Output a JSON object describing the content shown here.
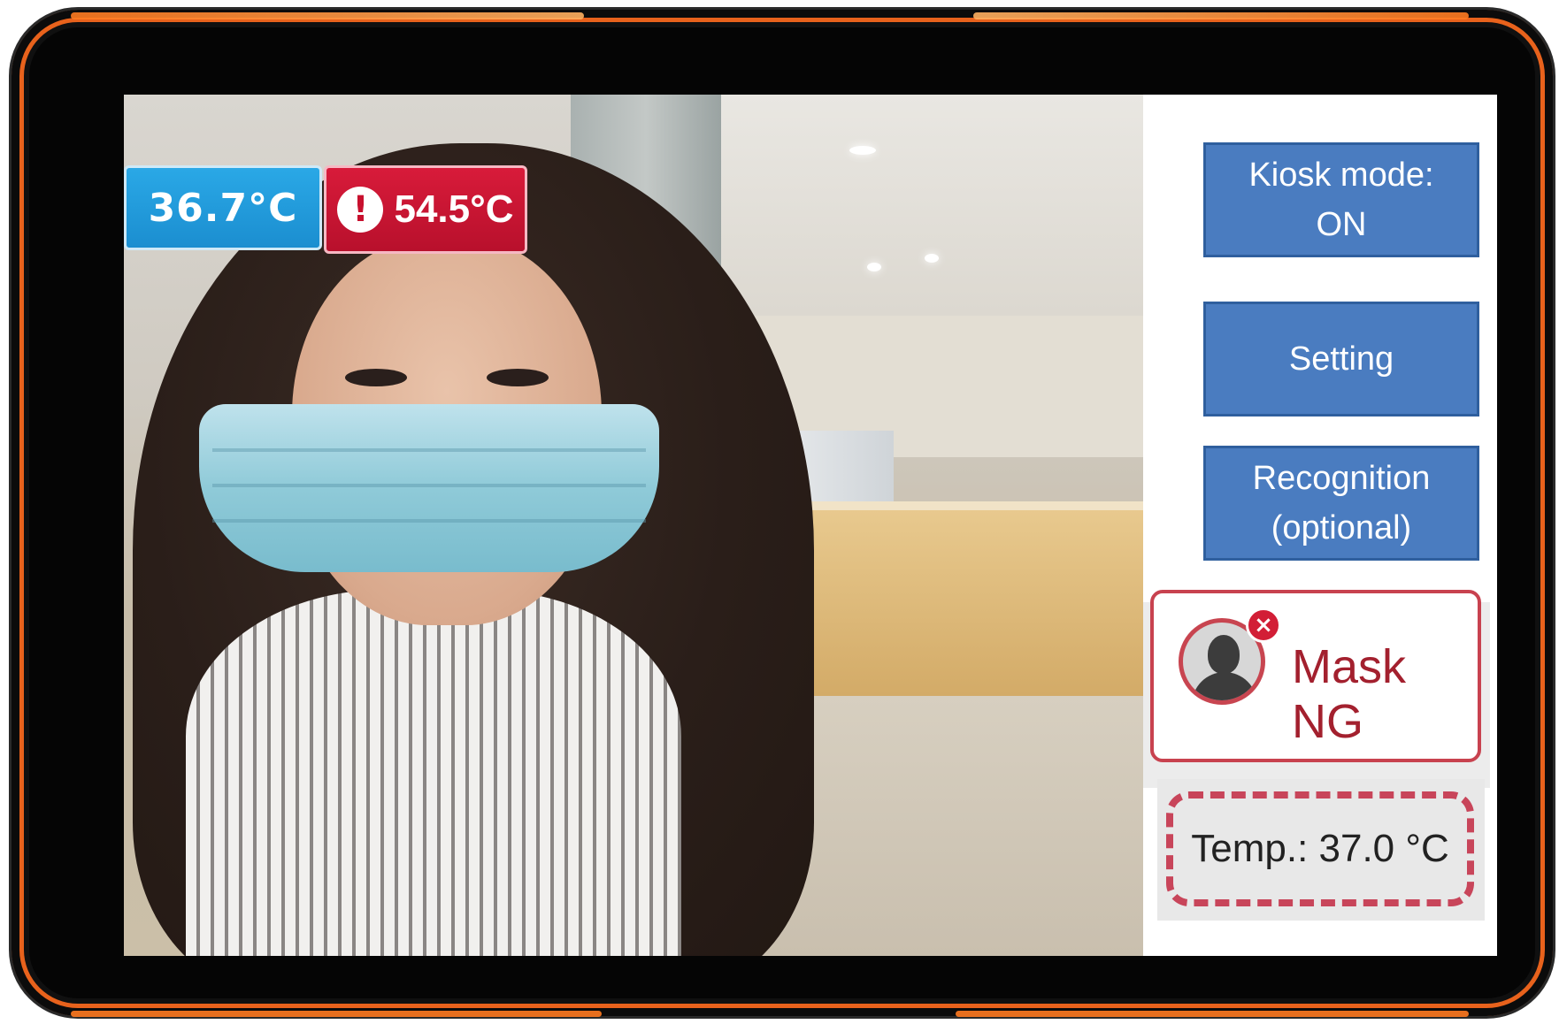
{
  "camera_view": {
    "temp_reading_normal": "36.7°C",
    "temp_reading_alert": "54.5°C",
    "alert_symbol": "!"
  },
  "side_panel": {
    "kiosk_button": {
      "line1": "Kiosk mode:",
      "line2": "ON"
    },
    "setting_button": {
      "label": "Setting"
    },
    "recognition_button": {
      "line1": "Recognition",
      "line2": "(optional)"
    },
    "mask_status": {
      "label": "Mask NG",
      "icon": "person-icon",
      "badge": "×"
    },
    "temperature_status": {
      "label": "Temp.:  37.0 °C"
    }
  },
  "colors": {
    "accent_blue": "#4a7cc0",
    "badge_blue": "#1b8ed0",
    "alert_red": "#c8102e",
    "bezel_orange": "#e8621c"
  }
}
